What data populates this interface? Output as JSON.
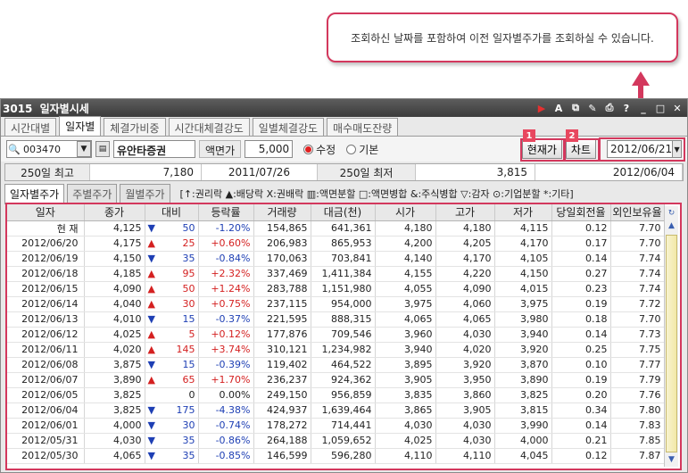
{
  "callout": {
    "text": "조회하신 날짜를 포함하여 이전 일자별주가를 조회하실 수 있습니다."
  },
  "window": {
    "screen_no": "3015",
    "title": "일자별시세"
  },
  "tabs": [
    "시간대별",
    "일자별",
    "체결가비중",
    "시간대체결강도",
    "일별체결강도",
    "매수매도잔량"
  ],
  "toolbar": {
    "code": "003470",
    "name": "유안타증권",
    "face_label": "액면가",
    "face_value": "5,000",
    "radio_modified": "수정",
    "radio_basic": "기본",
    "current_btn": "현재가",
    "chart_btn": "차트",
    "badge1": "1",
    "badge2": "2",
    "date": "2012/06/21"
  },
  "info": {
    "high_label": "250일 최고",
    "high_value": "7,180",
    "high_date": "2011/07/26",
    "low_label": "250일 최저",
    "low_value": "3,815",
    "low_date": "2012/06/04"
  },
  "subtabs": [
    "일자별주가",
    "주별주가",
    "월별주가"
  ],
  "legend": "[↑:권리락 ▲:배당락 X:권배락 ▥:액면분할 □:액면병합 &:주식병합 ▽:감자 ⊙:기업분할 *:기타]",
  "columns": [
    "일자",
    "종가",
    "대비",
    "등락률",
    "거래량",
    "대금(천)",
    "시가",
    "고가",
    "저가",
    "당일회전율",
    "외인보유율"
  ],
  "rows": [
    {
      "date": "현  재",
      "close": "4,125",
      "dir": "down",
      "chg": "50",
      "rate": "-1.20%",
      "vol": "154,865",
      "amt": "641,361",
      "open": "4,180",
      "high": "4,180",
      "low": "4,115",
      "turn": "0.12",
      "foreign": "7.70"
    },
    {
      "date": "2012/06/20",
      "close": "4,175",
      "dir": "up",
      "chg": "25",
      "rate": "+0.60%",
      "vol": "206,983",
      "amt": "865,953",
      "open": "4,200",
      "high": "4,205",
      "low": "4,170",
      "turn": "0.17",
      "foreign": "7.70"
    },
    {
      "date": "2012/06/19",
      "close": "4,150",
      "dir": "down",
      "chg": "35",
      "rate": "-0.84%",
      "vol": "170,063",
      "amt": "703,841",
      "open": "4,140",
      "high": "4,170",
      "low": "4,105",
      "turn": "0.14",
      "foreign": "7.74"
    },
    {
      "date": "2012/06/18",
      "close": "4,185",
      "dir": "up",
      "chg": "95",
      "rate": "+2.32%",
      "vol": "337,469",
      "amt": "1,411,384",
      "open": "4,155",
      "high": "4,220",
      "low": "4,150",
      "turn": "0.27",
      "foreign": "7.74"
    },
    {
      "date": "2012/06/15",
      "close": "4,090",
      "dir": "up",
      "chg": "50",
      "rate": "+1.24%",
      "vol": "283,788",
      "amt": "1,151,980",
      "open": "4,055",
      "high": "4,090",
      "low": "4,015",
      "turn": "0.23",
      "foreign": "7.74"
    },
    {
      "date": "2012/06/14",
      "close": "4,040",
      "dir": "up",
      "chg": "30",
      "rate": "+0.75%",
      "vol": "237,115",
      "amt": "954,000",
      "open": "3,975",
      "high": "4,060",
      "low": "3,975",
      "turn": "0.19",
      "foreign": "7.72"
    },
    {
      "date": "2012/06/13",
      "close": "4,010",
      "dir": "down",
      "chg": "15",
      "rate": "-0.37%",
      "vol": "221,595",
      "amt": "888,315",
      "open": "4,065",
      "high": "4,065",
      "low": "3,980",
      "turn": "0.18",
      "foreign": "7.70"
    },
    {
      "date": "2012/06/12",
      "close": "4,025",
      "dir": "up",
      "chg": "5",
      "rate": "+0.12%",
      "vol": "177,876",
      "amt": "709,546",
      "open": "3,960",
      "high": "4,030",
      "low": "3,940",
      "turn": "0.14",
      "foreign": "7.73"
    },
    {
      "date": "2012/06/11",
      "close": "4,020",
      "dir": "up",
      "chg": "145",
      "rate": "+3.74%",
      "vol": "310,121",
      "amt": "1,234,982",
      "open": "3,940",
      "high": "4,020",
      "low": "3,920",
      "turn": "0.25",
      "foreign": "7.75"
    },
    {
      "date": "2012/06/08",
      "close": "3,875",
      "dir": "down",
      "chg": "15",
      "rate": "-0.39%",
      "vol": "119,402",
      "amt": "464,522",
      "open": "3,895",
      "high": "3,920",
      "low": "3,870",
      "turn": "0.10",
      "foreign": "7.77"
    },
    {
      "date": "2012/06/07",
      "close": "3,890",
      "dir": "up",
      "chg": "65",
      "rate": "+1.70%",
      "vol": "236,237",
      "amt": "924,362",
      "open": "3,905",
      "high": "3,950",
      "low": "3,890",
      "turn": "0.19",
      "foreign": "7.79"
    },
    {
      "date": "2012/06/05",
      "close": "3,825",
      "dir": "none",
      "chg": "0",
      "rate": "0.00%",
      "vol": "249,150",
      "amt": "956,859",
      "open": "3,835",
      "high": "3,860",
      "low": "3,825",
      "turn": "0.20",
      "foreign": "7.76"
    },
    {
      "date": "2012/06/04",
      "close": "3,825",
      "dir": "down",
      "chg": "175",
      "rate": "-4.38%",
      "vol": "424,937",
      "amt": "1,639,464",
      "open": "3,865",
      "high": "3,905",
      "low": "3,815",
      "turn": "0.34",
      "foreign": "7.80"
    },
    {
      "date": "2012/06/01",
      "close": "4,000",
      "dir": "down",
      "chg": "30",
      "rate": "-0.74%",
      "vol": "178,272",
      "amt": "714,441",
      "open": "4,030",
      "high": "4,030",
      "low": "3,990",
      "turn": "0.14",
      "foreign": "7.83"
    },
    {
      "date": "2012/05/31",
      "close": "4,030",
      "dir": "down",
      "chg": "35",
      "rate": "-0.86%",
      "vol": "264,188",
      "amt": "1,059,652",
      "open": "4,025",
      "high": "4,030",
      "low": "4,000",
      "turn": "0.21",
      "foreign": "7.85"
    },
    {
      "date": "2012/05/30",
      "close": "4,065",
      "dir": "down",
      "chg": "35",
      "rate": "-0.85%",
      "vol": "146,599",
      "amt": "596,280",
      "open": "4,110",
      "high": "4,110",
      "low": "4,045",
      "turn": "0.12",
      "foreign": "7.87"
    }
  ],
  "colors": {
    "accent": "#d3385d",
    "up": "#d42020",
    "down": "#1e3fb4"
  }
}
